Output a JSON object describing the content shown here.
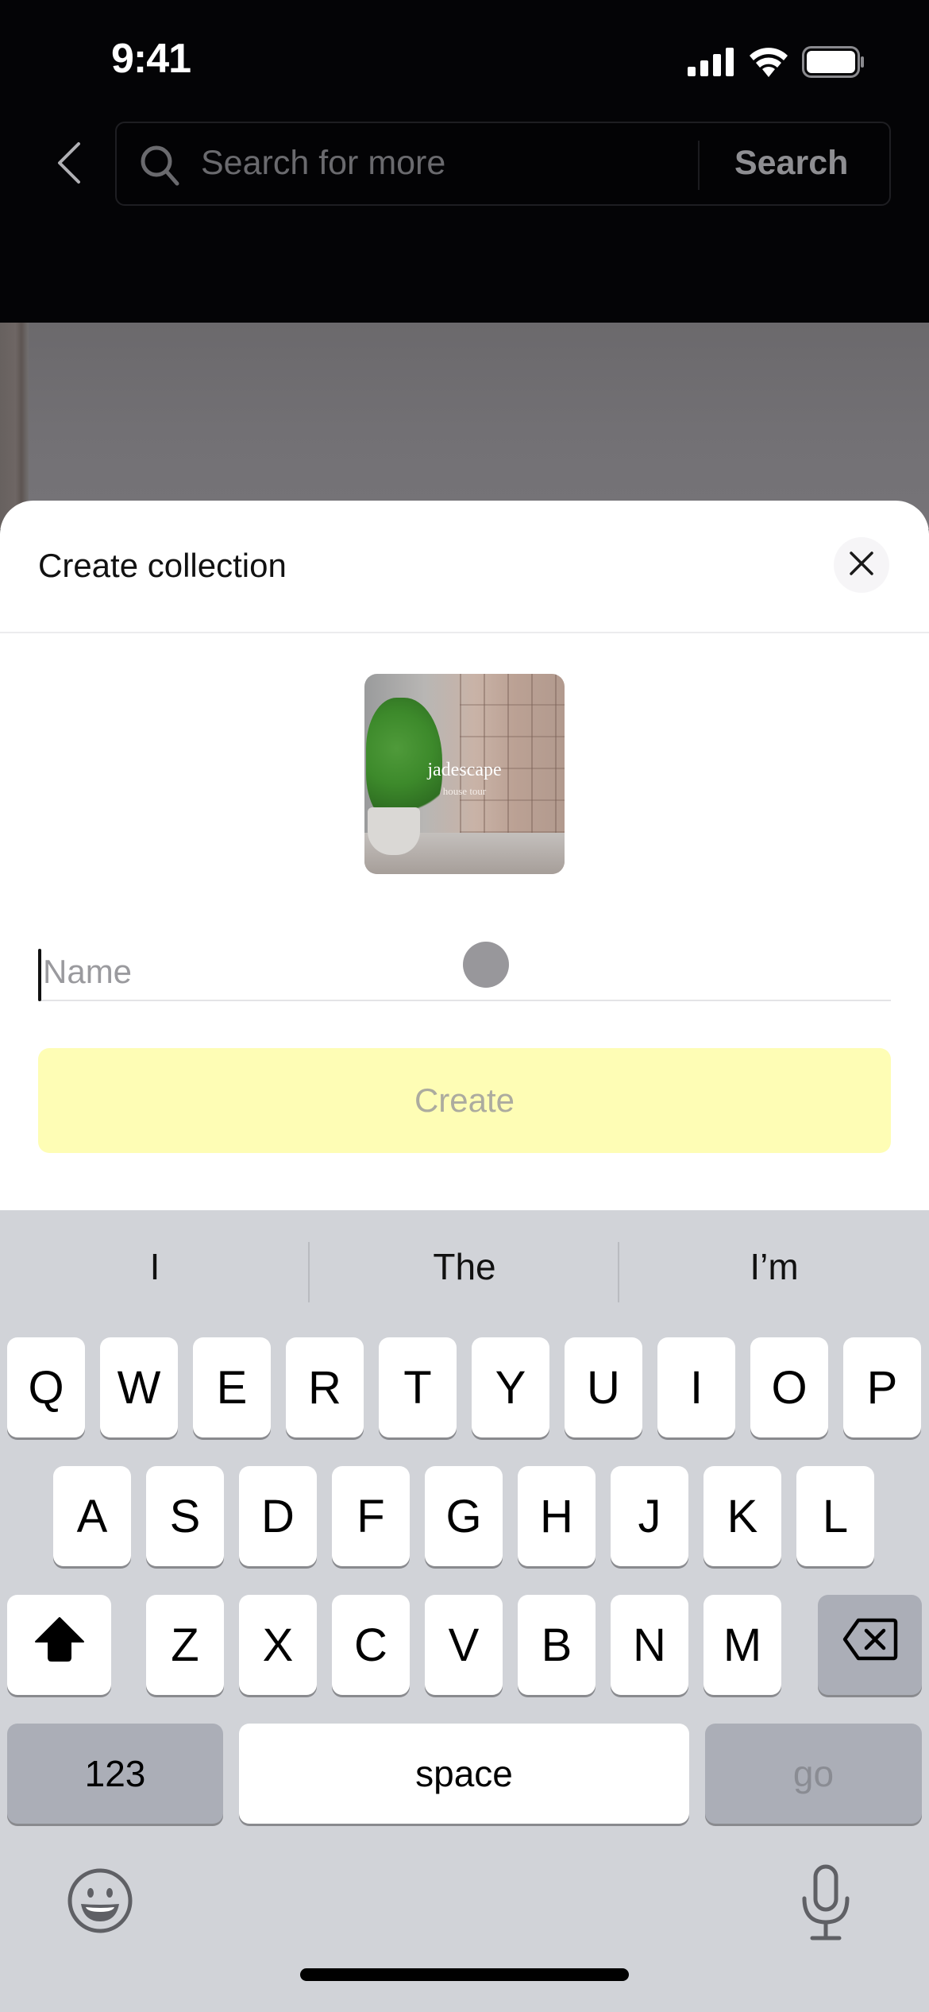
{
  "status_bar": {
    "time": "9:41",
    "icons": [
      "cellular-signal-icon",
      "wifi-icon",
      "battery-icon"
    ]
  },
  "nav": {
    "back_icon": "chevron-left-icon",
    "search": {
      "icon": "search-icon",
      "placeholder": "Search for more",
      "button_label": "Search"
    }
  },
  "sheet": {
    "title": "Create collection",
    "close_icon": "close-icon",
    "cover": {
      "title": "jadescape",
      "subtitle": "house tour"
    },
    "name_field": {
      "placeholder": "Name",
      "value": ""
    },
    "create_button": {
      "label": "Create",
      "enabled": false
    },
    "colors": {
      "create_button_bg": "#fefdb5",
      "create_button_text": "#acab9f"
    }
  },
  "keyboard": {
    "suggestions": [
      "I",
      "The",
      "I’m"
    ],
    "rows": [
      [
        "Q",
        "W",
        "E",
        "R",
        "T",
        "Y",
        "U",
        "I",
        "O",
        "P"
      ],
      [
        "A",
        "S",
        "D",
        "F",
        "G",
        "H",
        "J",
        "K",
        "L"
      ],
      [
        "Z",
        "X",
        "C",
        "V",
        "B",
        "N",
        "M"
      ]
    ],
    "shift_icon": "shift-icon",
    "delete_icon": "backspace-icon",
    "numbers_label": "123",
    "space_label": "space",
    "return_label": "go",
    "emoji_icon": "emoji-icon",
    "mic_icon": "microphone-icon"
  }
}
